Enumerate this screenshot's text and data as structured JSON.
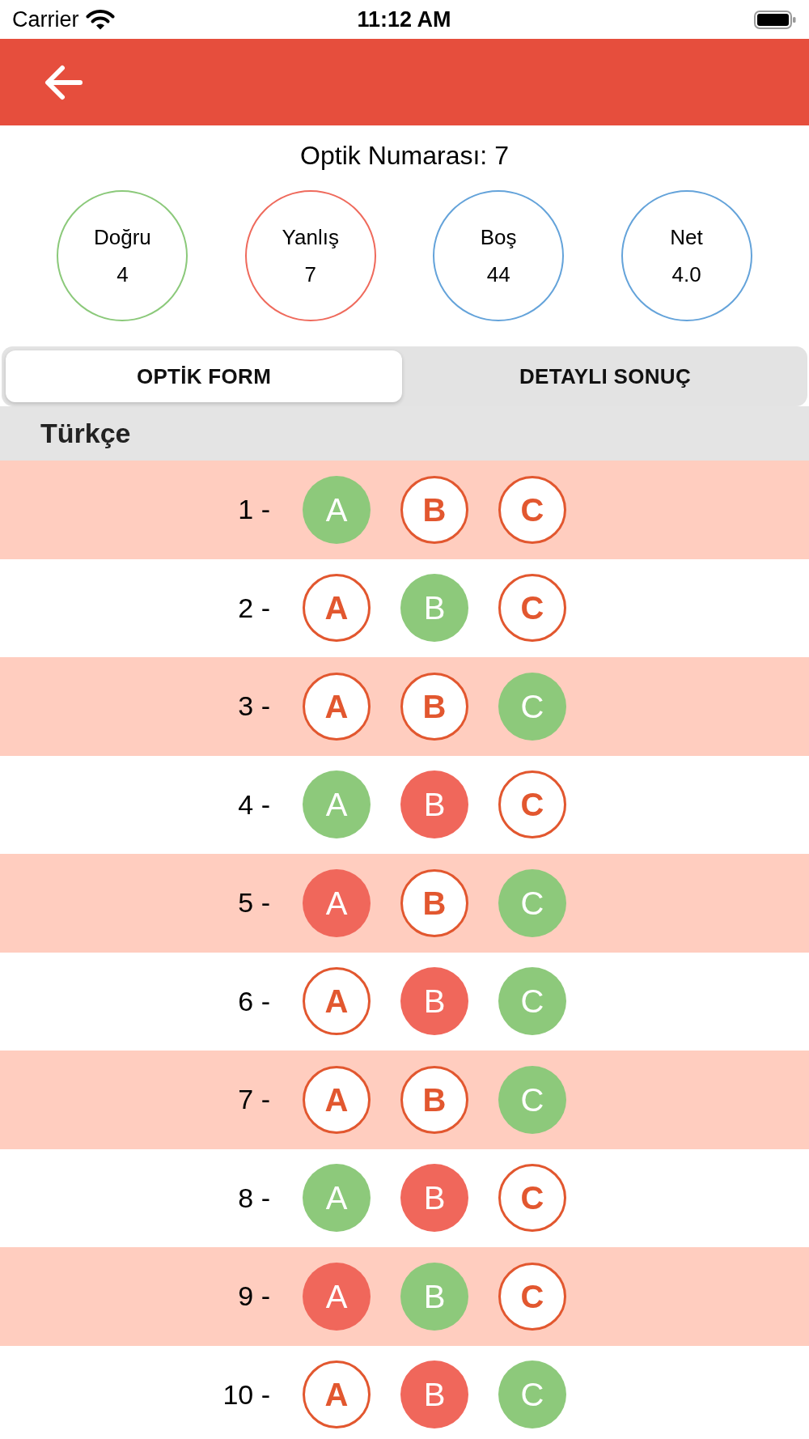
{
  "status_bar": {
    "carrier": "Carrier",
    "time": "11:12 AM"
  },
  "optic_number": "Optik Numarası: 7",
  "stats": [
    {
      "label": "Doğru",
      "value": "4",
      "color": "#8bc97a"
    },
    {
      "label": "Yanlış",
      "value": "7",
      "color": "#ef6a5c"
    },
    {
      "label": "Boş",
      "value": "44",
      "color": "#64a3da"
    },
    {
      "label": "Net",
      "value": "4.0",
      "color": "#64a3da"
    }
  ],
  "tabs": [
    {
      "label": "OPTİK FORM",
      "selected": true
    },
    {
      "label": "DETAYLI SONUÇ",
      "selected": false
    }
  ],
  "section": {
    "title": "Türkçe",
    "questions": [
      {
        "number": "1 -",
        "options": [
          {
            "label": "A",
            "correct": true,
            "wrong": false
          },
          {
            "label": "B",
            "correct": false,
            "wrong": false
          },
          {
            "label": "C",
            "correct": false,
            "wrong": false
          }
        ]
      },
      {
        "number": "2 -",
        "options": [
          {
            "label": "A",
            "correct": false,
            "wrong": false
          },
          {
            "label": "B",
            "correct": true,
            "wrong": false
          },
          {
            "label": "C",
            "correct": false,
            "wrong": false
          }
        ]
      },
      {
        "number": "3 -",
        "options": [
          {
            "label": "A",
            "correct": false,
            "wrong": false
          },
          {
            "label": "B",
            "correct": false,
            "wrong": false
          },
          {
            "label": "C",
            "correct": true,
            "wrong": false
          }
        ]
      },
      {
        "number": "4 -",
        "options": [
          {
            "label": "A",
            "correct": true,
            "wrong": false
          },
          {
            "label": "B",
            "correct": false,
            "wrong": true
          },
          {
            "label": "C",
            "correct": false,
            "wrong": false
          }
        ]
      },
      {
        "number": "5 -",
        "options": [
          {
            "label": "A",
            "correct": false,
            "wrong": true
          },
          {
            "label": "B",
            "correct": false,
            "wrong": false
          },
          {
            "label": "C",
            "correct": true,
            "wrong": false
          }
        ]
      },
      {
        "number": "6 -",
        "options": [
          {
            "label": "A",
            "correct": false,
            "wrong": false
          },
          {
            "label": "B",
            "correct": false,
            "wrong": true
          },
          {
            "label": "C",
            "correct": true,
            "wrong": false
          }
        ]
      },
      {
        "number": "7 -",
        "options": [
          {
            "label": "A",
            "correct": false,
            "wrong": false
          },
          {
            "label": "B",
            "correct": false,
            "wrong": false
          },
          {
            "label": "C",
            "correct": true,
            "wrong": false
          }
        ]
      },
      {
        "number": "8 -",
        "options": [
          {
            "label": "A",
            "correct": true,
            "wrong": false
          },
          {
            "label": "B",
            "correct": false,
            "wrong": true
          },
          {
            "label": "C",
            "correct": false,
            "wrong": false
          }
        ]
      },
      {
        "number": "9 -",
        "options": [
          {
            "label": "A",
            "correct": false,
            "wrong": true
          },
          {
            "label": "B",
            "correct": true,
            "wrong": false
          },
          {
            "label": "C",
            "correct": false,
            "wrong": false
          }
        ]
      },
      {
        "number": "10 -",
        "options": [
          {
            "label": "A",
            "correct": false,
            "wrong": false
          },
          {
            "label": "B",
            "correct": false,
            "wrong": true
          },
          {
            "label": "C",
            "correct": true,
            "wrong": false
          }
        ]
      }
    ]
  }
}
